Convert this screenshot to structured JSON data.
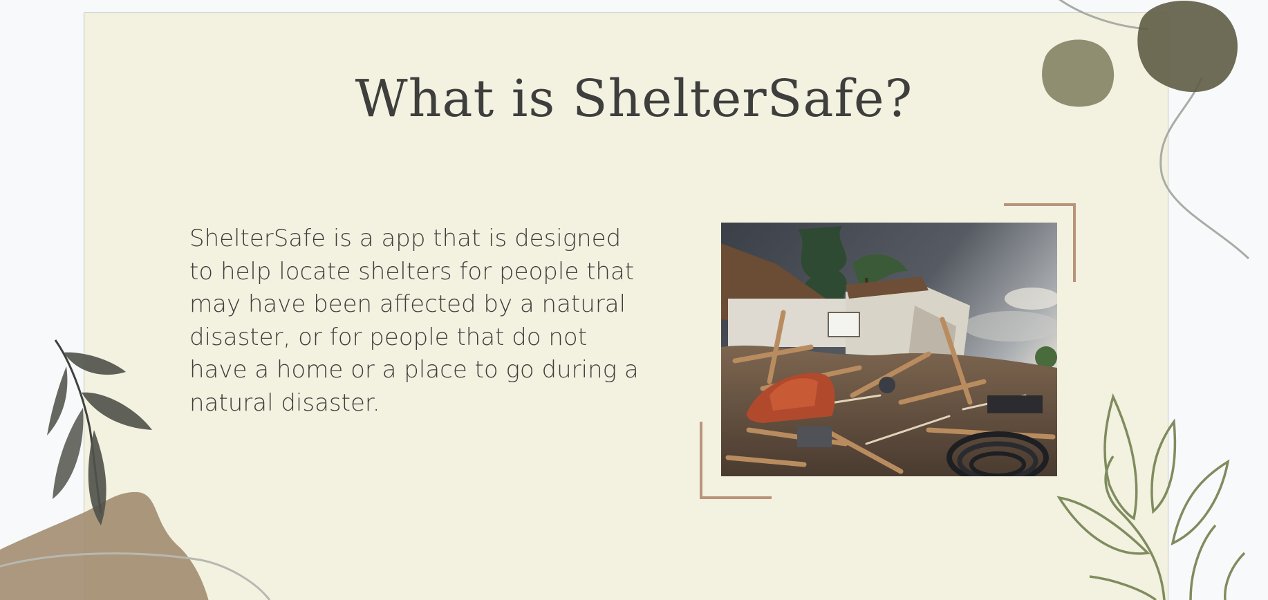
{
  "slide": {
    "title": "What is ShelterSafe?",
    "body": "ShelterSafe is a app that is designed to help locate shelters for people that may have been affected by a natural disaster, or for people that do not have a home or a place to go during a natural disaster."
  },
  "colors": {
    "background": "#f8f9fb",
    "card": "#f3f1e0",
    "text": "#3e3e3c",
    "bracket": "#b8957a",
    "olive_leaf": "#7f8c5e",
    "dark_leaf": "#4f514a",
    "watercolor_brown": "#a28d70",
    "watercolor_olive": "#6c6b51"
  },
  "icons": [
    "dark-leaf-branch-icon",
    "outline-leaf-branch-icon",
    "watercolor-blob-icon"
  ]
}
